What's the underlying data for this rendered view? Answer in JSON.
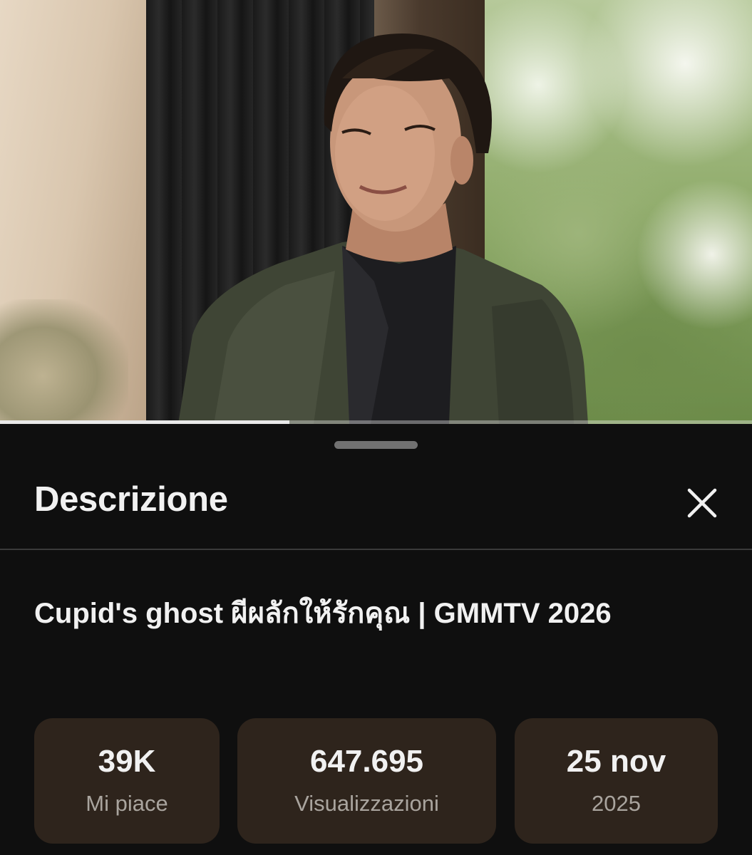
{
  "video": {
    "progress": 0.385
  },
  "sheet": {
    "title": "Descrizione",
    "close_icon": "close-icon"
  },
  "video_info": {
    "title": "Cupid's ghost ผีผลักให้รักคุณ | GMMTV 2026"
  },
  "stats": {
    "likes_value": "39K",
    "likes_label": "Mi piace",
    "views_value": "647.695",
    "views_label": "Visualizzazioni",
    "date_value": "25 nov",
    "date_label": "2025"
  },
  "colors": {
    "background": "#0f0f0f",
    "card": "#2e241c",
    "text_primary": "#f1f1f1",
    "text_secondary": "#a9a49e",
    "progress": "#e9e9e9"
  }
}
